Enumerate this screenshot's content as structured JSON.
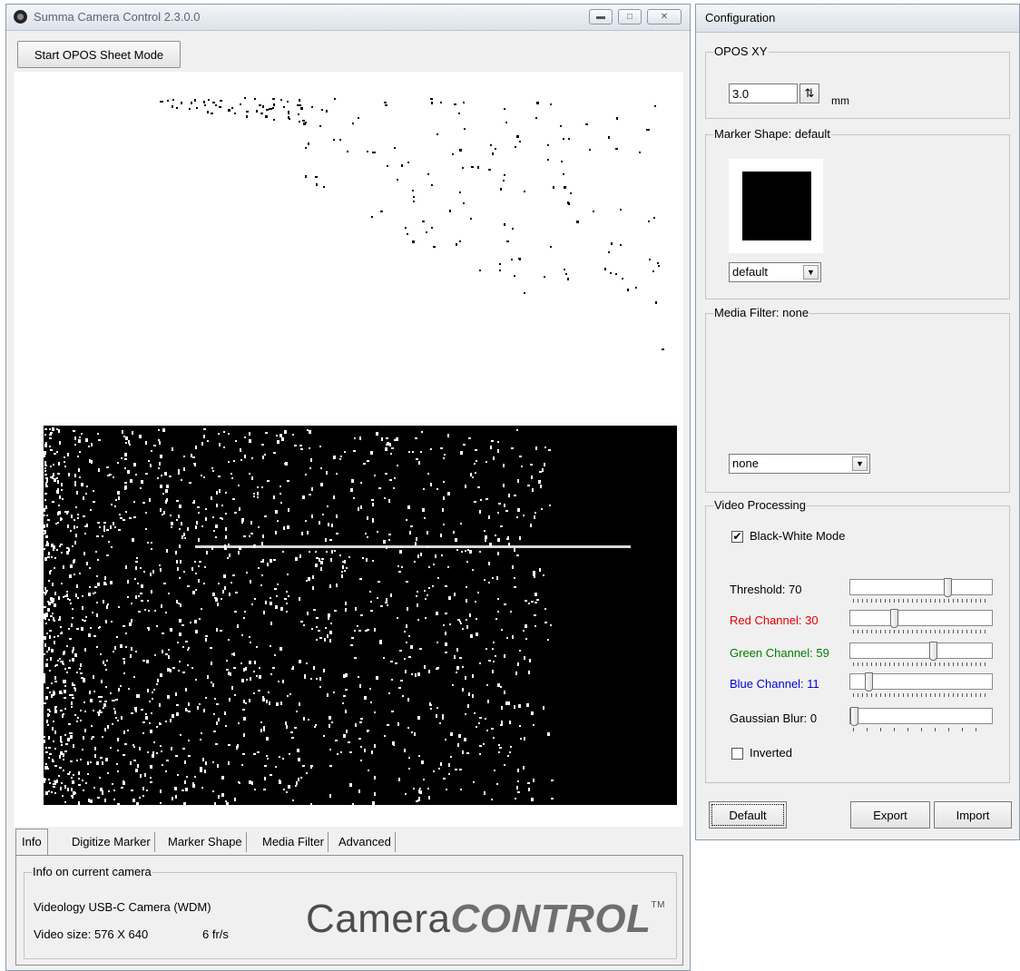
{
  "main_window": {
    "title": "Summa Camera Control 2.3.0.0",
    "start_button": "Start OPOS Sheet Mode",
    "tabs": [
      "Info",
      "Digitize Marker",
      "Marker Shape",
      "Media Filter",
      "Advanced"
    ],
    "active_tab": "Info",
    "info": {
      "group_title": "Info on current camera",
      "camera_name": "Videology USB-C Camera (WDM)",
      "video_size": "Video size: 576 X 640",
      "frame_rate": "6 fr/s",
      "logo_text_light": "Camera",
      "logo_text_bold": "CONTROL",
      "logo_tm": "TM"
    }
  },
  "config_window": {
    "title": "Configuration",
    "opos_xy": {
      "group_title": "OPOS XY",
      "value": "3.0",
      "unit": "mm"
    },
    "marker_shape": {
      "group_title": "Marker Shape: default",
      "selected": "default"
    },
    "media_filter": {
      "group_title": "Media Filter: none",
      "selected": "none"
    },
    "video_processing": {
      "group_title": "Video Processing",
      "bw_mode_label": "Black-White Mode",
      "bw_mode_checked": true,
      "sliders": [
        {
          "label": "Threshold: 70",
          "value": 70,
          "max": 100,
          "color": "#000000"
        },
        {
          "label": "Red Channel: 30",
          "value": 30,
          "max": 100,
          "color": "#e00000"
        },
        {
          "label": "Green Channel: 59",
          "value": 59,
          "max": 100,
          "color": "#008000"
        },
        {
          "label": "Blue Channel: 11",
          "value": 11,
          "max": 100,
          "color": "#0000e0"
        },
        {
          "label": "Gaussian Blur: 0",
          "value": 0,
          "max": 10,
          "color": "#000000"
        }
      ],
      "inverted_label": "Inverted",
      "inverted_checked": false
    },
    "buttons": {
      "default": "Default",
      "export": "Export",
      "import": "Import"
    }
  }
}
